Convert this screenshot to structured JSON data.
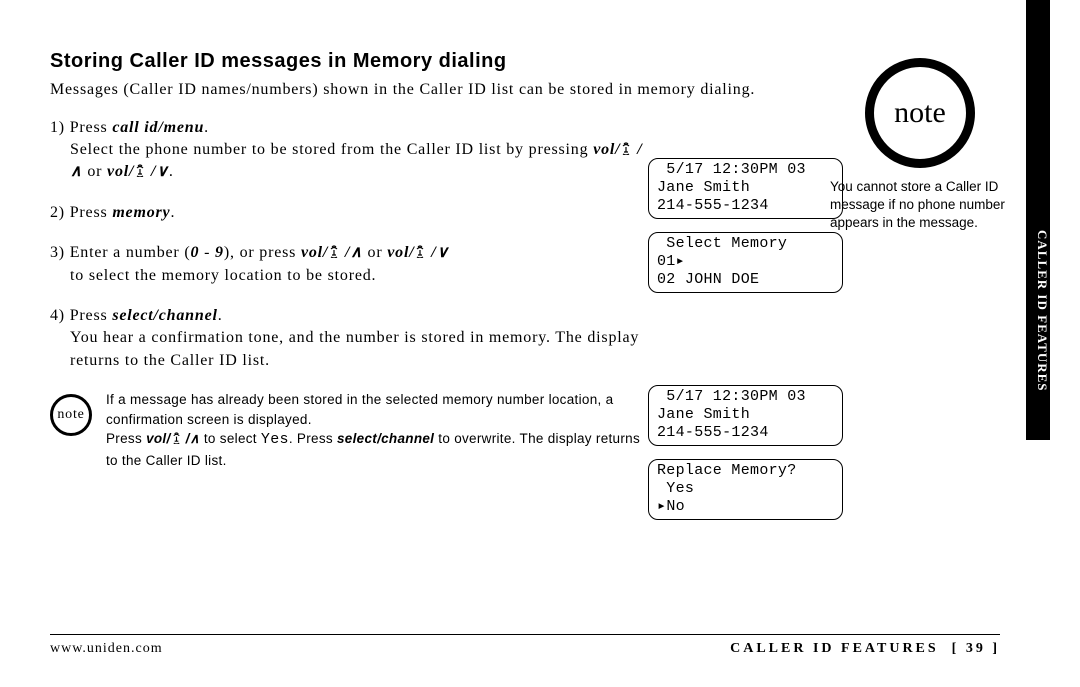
{
  "heading": "Storing Caller ID messages in Memory dialing",
  "intro": "Messages (Caller ID names/numbers) shown in the Caller ID list can be stored in memory dialing.",
  "steps": {
    "s1_a": "1) Press ",
    "s1_b": "call id/menu",
    "s1_c": ".",
    "s1_line2a": "Select the phone number to be stored from the Caller ID list by pressing ",
    "s1_vol1": "vol/",
    "s1_or": " or ",
    "s1_dot": ".",
    "s2_a": "2) Press ",
    "s2_b": "memory",
    "s2_c": ".",
    "s3_a": "3) Enter a number (",
    "s3_b": "0",
    "s3_c": " - ",
    "s3_d": "9",
    "s3_e": "), or press ",
    "s3_or": " or ",
    "s3_line2": "to select the memory location to be stored.",
    "s4_a": "4) Press ",
    "s4_b": "select/channel",
    "s4_c": ".",
    "s4_line2": "You hear a confirmation tone, and the number is stored in memory. The display returns to the Caller ID list."
  },
  "small_note": {
    "label": "note",
    "l1": "If a message has already been stored in the selected memory number location, a confirmation screen is displayed.",
    "l2a": "Press ",
    "l2b": "vol/",
    "l2c": " to select ",
    "l2d": "Yes",
    "l2e": ". Press ",
    "l2f": "select/channel",
    "l2g": " to overwrite. The display returns to the Caller ID list."
  },
  "big_note": {
    "label": "note",
    "text": "You cannot store a Caller ID message if no phone number appears in the message."
  },
  "lcd": {
    "d1": " 5/17 12:30PM 03\nJane Smith\n214-555-1234",
    "d2": " Select Memory\n01▸\n02 JOHN DOE",
    "d3": " 5/17 12:30PM 03\nJane Smith\n214-555-1234",
    "d4": "Replace Memory?\n Yes\n▸No"
  },
  "footer": {
    "url": "www.uniden.com",
    "section": "CALLER ID FEATURES",
    "page": "[ 39 ]"
  },
  "side_tab": "CALLER ID FEATURES"
}
